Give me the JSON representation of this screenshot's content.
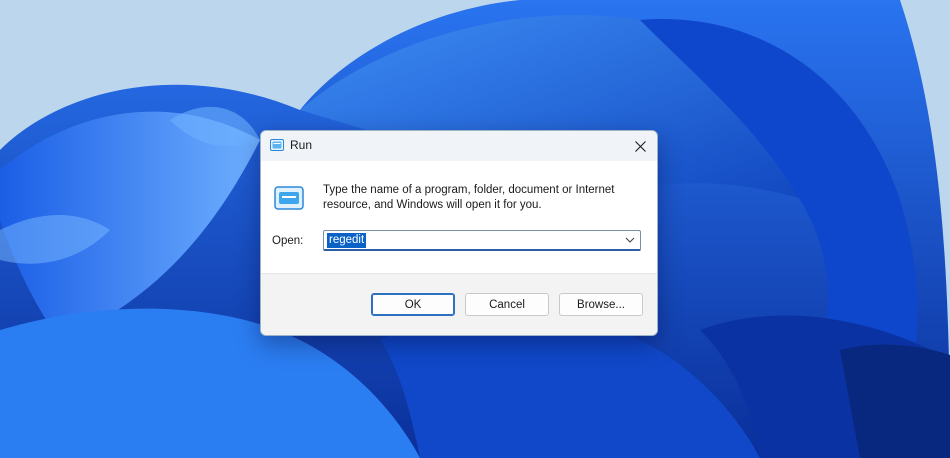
{
  "dialog": {
    "title": "Run",
    "close_icon": "close-icon",
    "description": "Type the name of a program, folder, document or Internet resource, and Windows will open it for you.",
    "open_label": "Open:",
    "open_value": "regedit",
    "dropdown_icon": "chevron-down-icon",
    "buttons": {
      "ok": "OK",
      "cancel": "Cancel",
      "browse": "Browse..."
    }
  },
  "colors": {
    "selection": "#0a62c6",
    "accent": "#2e6fbf",
    "wallpaper": "#1a5fe0"
  }
}
